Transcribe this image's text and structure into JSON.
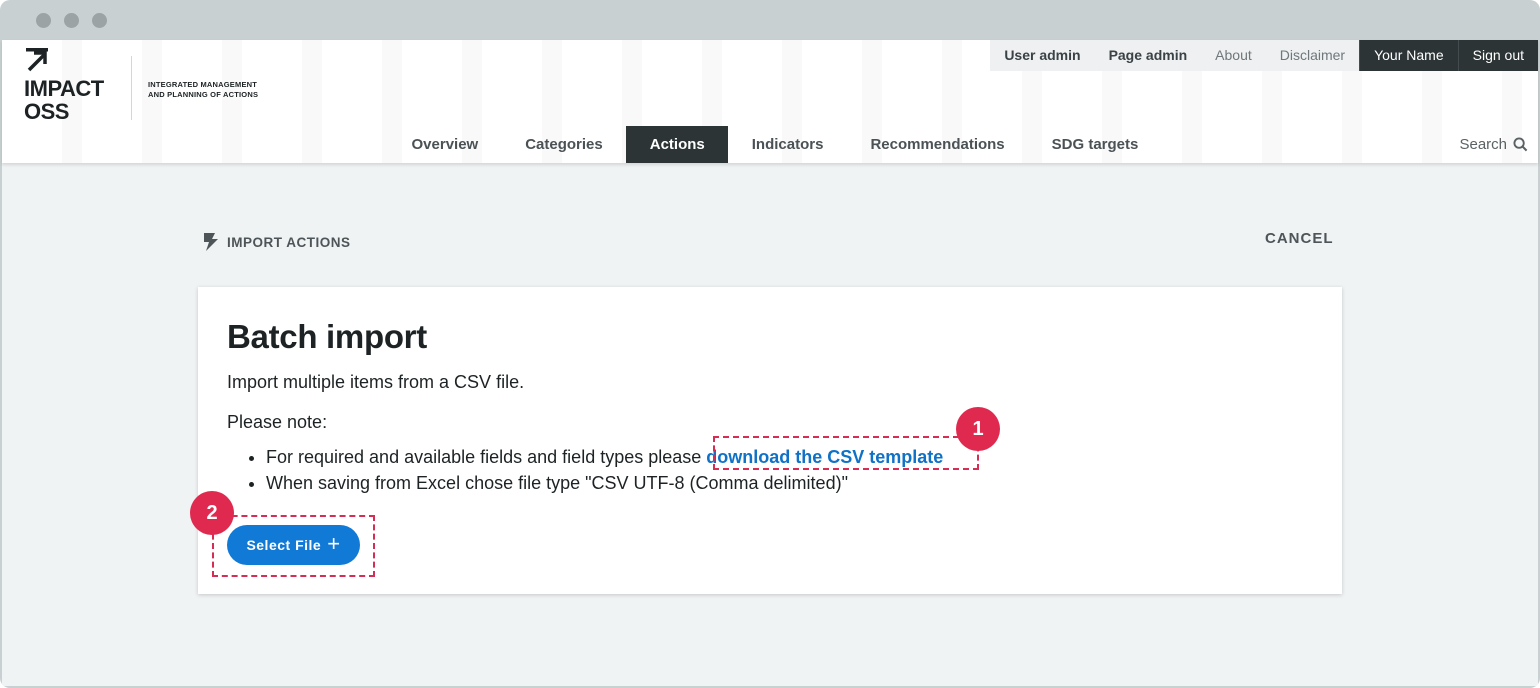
{
  "logo": {
    "name_line1": "IMPACT",
    "name_line2": "OSS",
    "tagline_line1": "INTEGRATED MANAGEMENT",
    "tagline_line2": "AND PLANNING OF ACTIONS"
  },
  "topbar": {
    "user_admin": "User admin",
    "page_admin": "Page admin",
    "about": "About",
    "disclaimer": "Disclaimer",
    "user_name": "Your Name",
    "sign_out": "Sign out"
  },
  "nav": {
    "items": [
      "Overview",
      "Categories",
      "Actions",
      "Indicators",
      "Recommendations",
      "SDG targets"
    ],
    "active": "Actions",
    "search_label": "Search"
  },
  "page": {
    "section_label": "IMPORT ACTIONS",
    "cancel_label": "CANCEL"
  },
  "card": {
    "title": "Batch import",
    "subtitle": "Import multiple items from a CSV file.",
    "note_label": "Please note:",
    "bullet1_text": "For required and available fields and field types please ",
    "bullet1_link": "download the CSV template",
    "bullet2_text": "When saving from Excel chose file type \"CSV UTF-8 (Comma delimited)\"",
    "select_file_label": "Select File"
  },
  "annotations": {
    "badge1": "1",
    "badge2": "2"
  },
  "colors": {
    "accent": "#1179d6",
    "link": "#0f72c7",
    "dark_nav": "#2c3436",
    "annotation": "#e0294f"
  },
  "icons": [
    "logo-arrow-icon",
    "search-icon",
    "lightning-icon",
    "plus-icon"
  ]
}
